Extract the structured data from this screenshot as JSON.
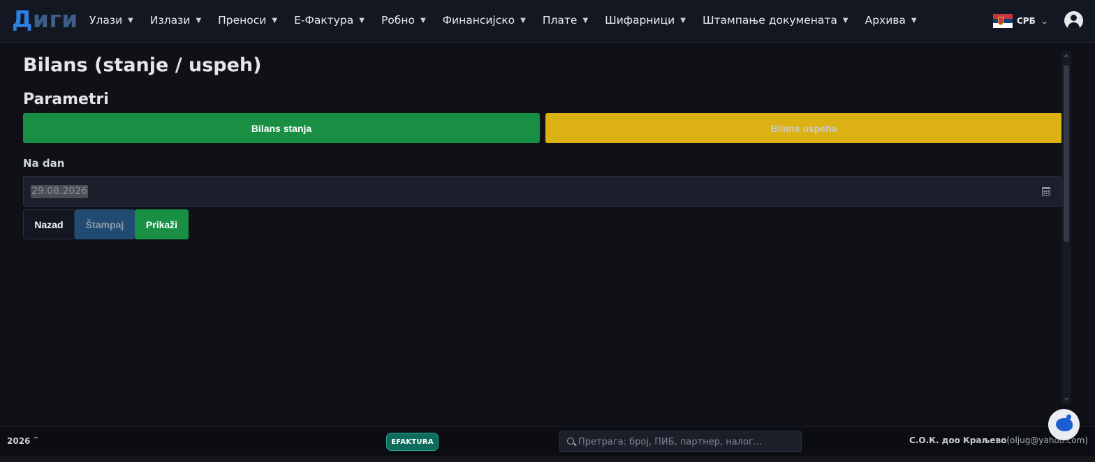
{
  "app": {
    "logo_part1": "Д",
    "logo_part2": "иги"
  },
  "nav": {
    "items": [
      {
        "label": "Улази"
      },
      {
        "label": "Излази"
      },
      {
        "label": "Преноси"
      },
      {
        "label": "Е-Фактура"
      },
      {
        "label": "Робно"
      },
      {
        "label": "Финансијско"
      },
      {
        "label": "Плате"
      },
      {
        "label": "Шифарници"
      },
      {
        "label": "Штампање докумената"
      },
      {
        "label": "Архива"
      }
    ],
    "language": "СРБ"
  },
  "page": {
    "title": "Bilans (stanje / uspeh)",
    "section_title": "Parametri",
    "btn_bilans_stanja": "Bilans stanja",
    "btn_bilans_uspeha": "Bilans uspeha",
    "date_label": "Na dan",
    "date_value": "29.08.2026",
    "btn_back": "Nazad",
    "btn_print": "Štampaj",
    "btn_show": "Prikaži"
  },
  "footer": {
    "year": "2026",
    "efaktura_badge": "EFAKTURA",
    "search_placeholder": "Претрага: број, ПИБ, партнер, налог...",
    "company_name": "С.О.К. доо Краљево",
    "company_email": "(oljug@yahoo.com)"
  },
  "colors": {
    "accent_green": "#198f44",
    "accent_yellow": "#dcb114",
    "accent_blue": "#214b73",
    "logo_blue": "#2f7fe0"
  }
}
